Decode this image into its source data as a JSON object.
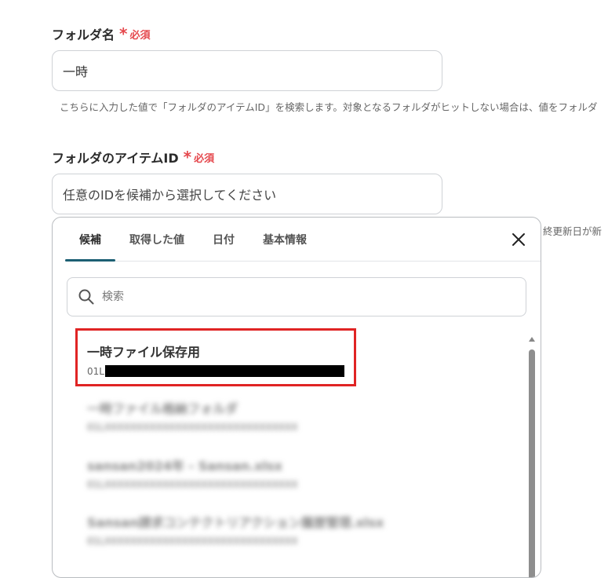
{
  "folder_name": {
    "label": "フォルダ名",
    "required_star": "*",
    "required_text": "必須",
    "value": "一時",
    "help": "こちらに入力した値で「フォルダのアイテムID」を検索します。対象となるフォルダがヒットしない場合は、値をフォルダ"
  },
  "folder_item_id": {
    "label": "フォルダのアイテムID",
    "required_star": "*",
    "required_text": "必須",
    "placeholder": "任意のIDを候補から選択してください",
    "side_help": "終更新日が新"
  },
  "panel": {
    "tabs": [
      {
        "label": "候補",
        "active": true
      },
      {
        "label": "取得した値",
        "active": false
      },
      {
        "label": "日付",
        "active": false
      },
      {
        "label": "基本情報",
        "active": false
      }
    ],
    "close_icon": "close-icon",
    "search_placeholder": "検索",
    "items": [
      {
        "title": "一時ファイル保存用",
        "id_prefix": "01L",
        "id_redacted": true,
        "highlighted": true
      },
      {
        "title": "一時ファイル格納フォルダ",
        "id": "01LXXXXXXXXXXXXXXXXXXXXXXXXXXXXXX",
        "blurred": true
      },
      {
        "title": "sansan2024年 - Sansan.xlsx",
        "id": "01LXXXXXXXXXXXXXXXXXXXXXXXXXXXXXX",
        "blurred": true
      },
      {
        "title": "Sansan請求コンテクトリアクション履歴管理.xlsx",
        "id": "01LXXXXXXXXXXXXXXXXXXXXXXXXXXXXXX",
        "blurred": true
      }
    ]
  },
  "colors": {
    "required": "#e5484d",
    "active_tab_underline": "#1c5f73",
    "highlight_border": "#e02424"
  }
}
